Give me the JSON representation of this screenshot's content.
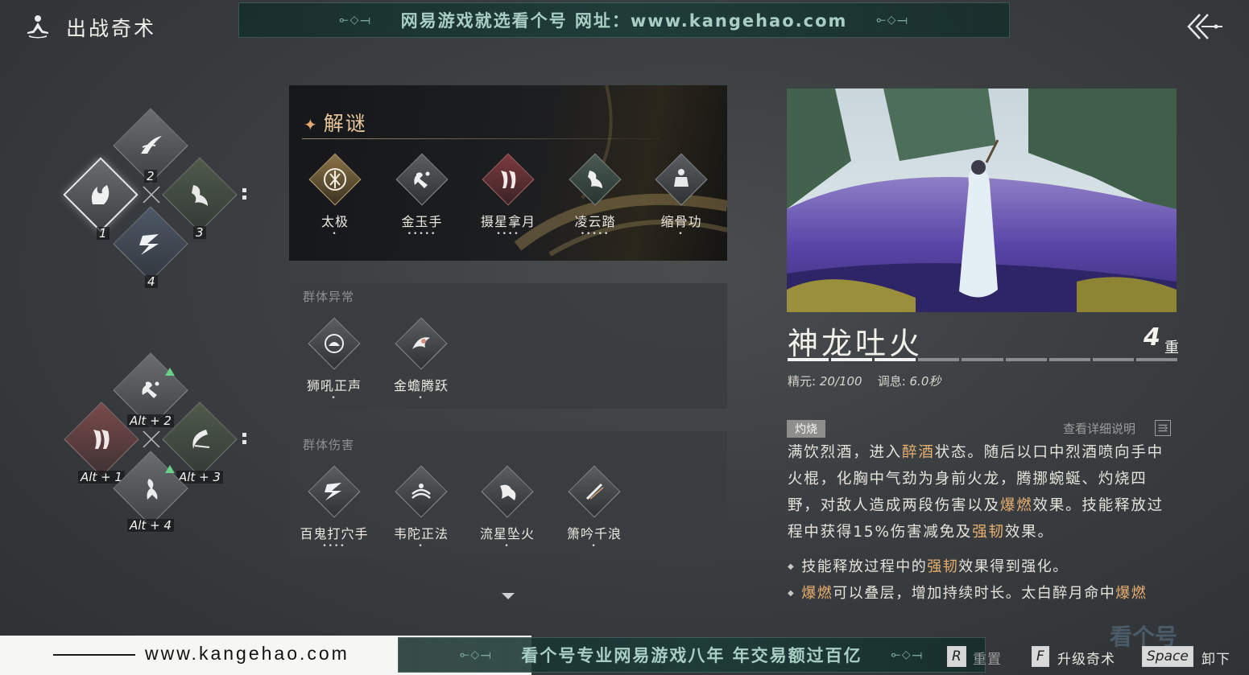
{
  "header": {
    "title": "出战奇术",
    "banner_text": "网易游戏就选看个号   网址：www.kangehao.com"
  },
  "slots_top": [
    {
      "num": "1"
    },
    {
      "num": "2"
    },
    {
      "num": "3"
    },
    {
      "num": "4"
    }
  ],
  "slots_bottom": [
    {
      "num": "Alt + 1"
    },
    {
      "num": "Alt + 2"
    },
    {
      "num": "Alt + 3"
    },
    {
      "num": "Alt + 4"
    }
  ],
  "puzzle": {
    "heading": "解谜",
    "skills": [
      {
        "name": "太极",
        "pips": "•"
      },
      {
        "name": "金玉手",
        "pips": "•••••"
      },
      {
        "name": "摄星拿月",
        "pips": "••••"
      },
      {
        "name": "凌云踏",
        "pips": "•••••"
      },
      {
        "name": "缩骨功",
        "pips": "•"
      }
    ]
  },
  "group1": {
    "label": "群体异常",
    "skills": [
      {
        "name": "狮吼正声",
        "pips": "•"
      },
      {
        "name": "金蟾腾跃",
        "pips": "•"
      }
    ]
  },
  "group2": {
    "label": "群体伤害",
    "skills": [
      {
        "name": "百鬼打穴手",
        "pips": "••••"
      },
      {
        "name": "韦陀正法",
        "pips": "•"
      },
      {
        "name": "流星坠火",
        "pips": "•"
      },
      {
        "name": "箫吟千浪",
        "pips": "•"
      }
    ]
  },
  "detail": {
    "name": "神龙吐火",
    "level": "4",
    "level_unit": "重",
    "level_filled": 3,
    "level_total": 9,
    "stats_label_1": "精元: ",
    "stats_value_1": "20/100",
    "stats_label_2": "调息: ",
    "stats_value_2": "6.0秒",
    "tag": "灼烧",
    "detail_link": "查看详细说明",
    "desc_1": "满饮烈酒，进入",
    "desc_hl_1": "醉酒",
    "desc_2": "状态。随后以口中烈酒喷向手中火棍，化胸中气劲为身前火龙，腾挪蜿蜒、灼烧四野，对敌人造成两段伤害以及",
    "desc_hl_2": "爆燃",
    "desc_3": "效果。技能释放过程中获得15%伤害减免及",
    "desc_hl_3": "强韧",
    "desc_4": "效果。",
    "bullet1_a": "技能释放过程中的",
    "bullet1_hl": "强韧",
    "bullet1_b": "效果得到强化。",
    "bullet2_hl_a": "爆燃",
    "bullet2_b": "可以叠层，增加持续时长。太白醉月命中",
    "bullet2_hl_b": "爆燃"
  },
  "footer": {
    "url": "www.kangehao.com",
    "banner_text": "看个号专业网易游戏八年   年交易额过百亿",
    "key_reset": "R",
    "reset_label": "重置",
    "key_upgrade": "F",
    "upgrade_label": "升级奇术",
    "key_unload": "Space",
    "unload_label": "卸下",
    "watermark": "看个号"
  }
}
